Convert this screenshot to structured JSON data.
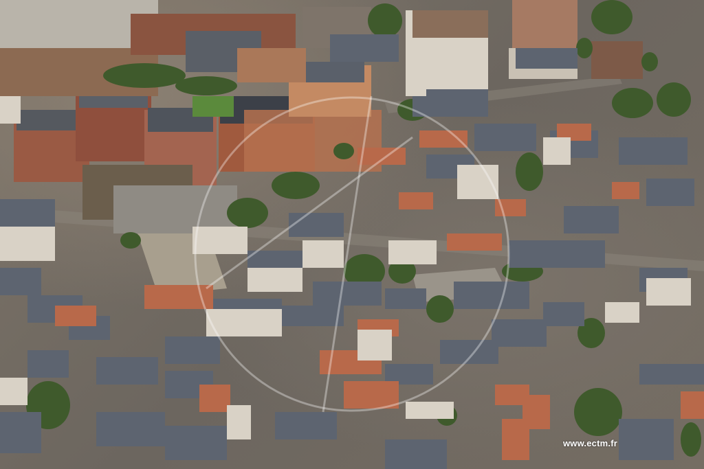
{
  "image": {
    "subject": "aerial-city-block",
    "watermark_text": "www.ectm.fr",
    "colors": {
      "roof_slate": "#5d6470",
      "roof_tile": "#b8694a",
      "facade_brick": "#9a5a44",
      "facade_light": "#d9d2c6",
      "tree": "#3f5a2c",
      "pavement": "#8b857b"
    }
  }
}
